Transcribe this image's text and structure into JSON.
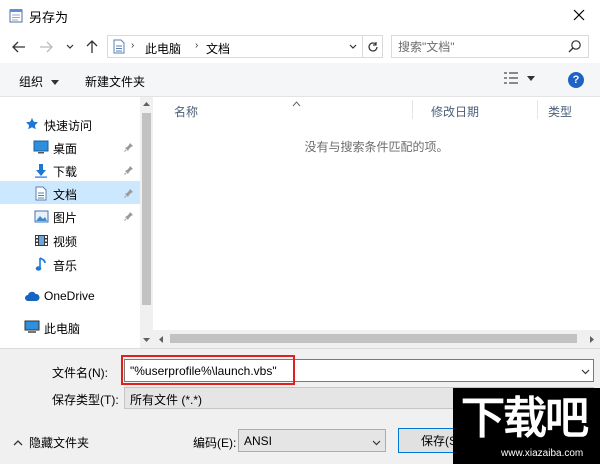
{
  "window": {
    "title": "另存为"
  },
  "navigation": {
    "breadcrumb": [
      "此电脑",
      "文档"
    ],
    "search_placeholder": "搜索\"文档\""
  },
  "toolbar": {
    "organize_label": "组织",
    "new_folder_label": "新建文件夹"
  },
  "sidebar": {
    "quick_access_label": "快速访问",
    "items": [
      {
        "label": "桌面",
        "icon": "desktop-icon",
        "pinned": true
      },
      {
        "label": "下载",
        "icon": "download-icon",
        "pinned": true
      },
      {
        "label": "文档",
        "icon": "document-icon",
        "pinned": true,
        "selected": true
      },
      {
        "label": "图片",
        "icon": "pictures-icon",
        "pinned": true
      },
      {
        "label": "视频",
        "icon": "videos-icon",
        "pinned": false
      },
      {
        "label": "音乐",
        "icon": "music-icon",
        "pinned": false
      }
    ],
    "onedrive_label": "OneDrive",
    "this_pc_label": "此电脑"
  },
  "file_list": {
    "columns": [
      "名称",
      "修改日期",
      "类型"
    ],
    "empty_message": "没有与搜索条件匹配的项。"
  },
  "save_form": {
    "filename_label": "文件名(N):",
    "filename_value": "\"%userprofile%\\launch.vbs\"",
    "filetype_label": "保存类型(T):",
    "filetype_value": "所有文件  (*.*)",
    "hide_folders_label": "隐藏文件夹",
    "encoding_label": "编码(E):",
    "encoding_value": "ANSI",
    "save_label": "保存(S)"
  },
  "watermark": {
    "logo_text": "下载吧",
    "site": "www.xiazaiba.com"
  },
  "colors": {
    "accent": "#0078d7",
    "selected_bg": "#cce8ff",
    "highlight_box": "#e0201d",
    "help_icon": "#1f62c6"
  }
}
